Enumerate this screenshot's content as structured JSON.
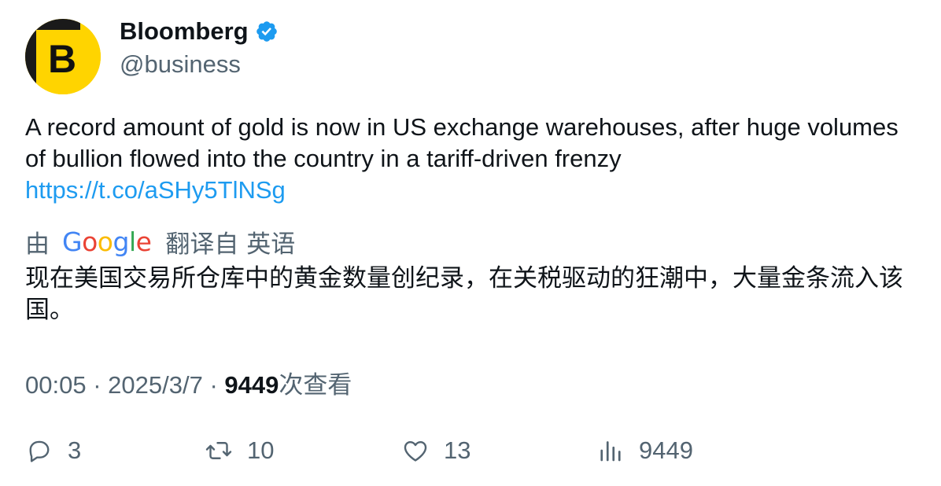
{
  "author": {
    "display_name": "Bloomberg",
    "handle": "@business",
    "avatar_letter": "B",
    "avatar_color": "#ffd400",
    "verified_color": "#1d9bf0"
  },
  "tweet": {
    "text": "A record amount of gold is now in US exchange warehouses, after huge volumes of bullion flowed into the country in a tariff-driven frenzy",
    "link": "https://t.co/aSHy5TlNSg"
  },
  "translation": {
    "prefix": "由",
    "provider_letters": [
      "G",
      "o",
      "o",
      "g",
      "l",
      "e"
    ],
    "suffix": "翻译自 英语",
    "text": "现在美国交易所仓库中的黄金数量创纪录，在关税驱动的狂潮中，大量金条流入该国。"
  },
  "meta": {
    "time": "00:05",
    "separator": "·",
    "date": "2025/3/7",
    "views_count": "9449",
    "views_label": "次查看"
  },
  "actions": {
    "replies": "3",
    "retweets": "10",
    "likes": "13",
    "views": "9449"
  },
  "colors": {
    "text_primary": "#0f1419",
    "text_secondary": "#536471",
    "link": "#1d9bf0"
  }
}
